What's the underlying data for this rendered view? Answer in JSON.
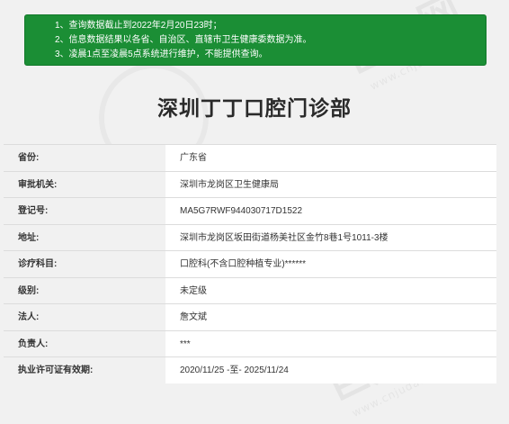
{
  "notice": {
    "lines": [
      "1、查询数据截止到2022年2月20日23时；",
      "2、信息数据结果以各省、自治区、直辖市卫生健康委数据为准。",
      "3、凌晨1点至凌晨5点系统进行维护，不能提供查询。"
    ]
  },
  "clinic_name": "深圳丁丁口腔门诊部",
  "fields": [
    {
      "label": "省份:",
      "value": "广东省"
    },
    {
      "label": "审批机关:",
      "value": "深圳市龙岗区卫生健康局"
    },
    {
      "label": "登记号:",
      "value": "MA5G7RWF944030717D1522"
    },
    {
      "label": "地址:",
      "value": "深圳市龙岗区坂田街道杨美社区金竹8巷1号1011-3楼"
    },
    {
      "label": "诊疗科目:",
      "value": "口腔科(不含口腔种植专业)******"
    },
    {
      "label": "级别:",
      "value": "未定级"
    },
    {
      "label": "法人:",
      "value": "詹文斌"
    },
    {
      "label": "负责人:",
      "value": "***"
    },
    {
      "label": "执业许可证有效期:",
      "value": "2020/11/25 -至- 2025/11/24"
    }
  ],
  "watermark": {
    "brand": "巨大网",
    "url": "www.cnjuda.com"
  },
  "colors": {
    "notice_bg": "#1b8e35",
    "page_bg": "#f1f1f1"
  }
}
